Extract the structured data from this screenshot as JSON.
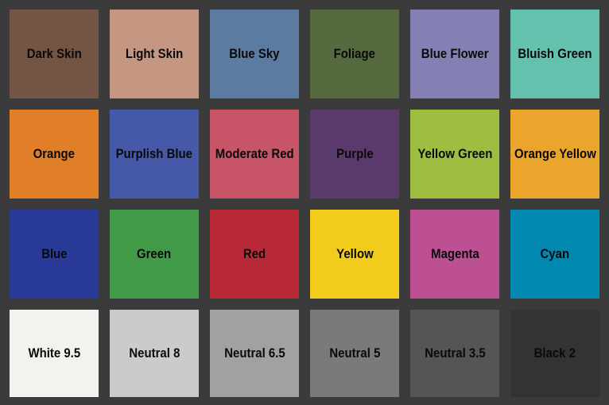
{
  "background_color": "#3b3b3b",
  "patches": [
    {
      "label": "Dark Skin",
      "color": "#745443"
    },
    {
      "label": "Light Skin",
      "color": "#c59682"
    },
    {
      "label": "Blue Sky",
      "color": "#5b7ba0"
    },
    {
      "label": "Foliage",
      "color": "#566a40"
    },
    {
      "label": "Blue Flower",
      "color": "#8580b3"
    },
    {
      "label": "Bluish Green",
      "color": "#63c1ae"
    },
    {
      "label": "Orange",
      "color": "#e07f28"
    },
    {
      "label": "Purplish Blue",
      "color": "#4559a8"
    },
    {
      "label": "Moderate Red",
      "color": "#c85467"
    },
    {
      "label": "Purple",
      "color": "#5a3a6c"
    },
    {
      "label": "Yellow Green",
      "color": "#9fbd40"
    },
    {
      "label": "Orange Yellow",
      "color": "#eba52c"
    },
    {
      "label": "Blue",
      "color": "#2a3a98"
    },
    {
      "label": "Green",
      "color": "#419a48"
    },
    {
      "label": "Red",
      "color": "#b92a38"
    },
    {
      "label": "Yellow",
      "color": "#f2cc1c"
    },
    {
      "label": "Magenta",
      "color": "#bd5092"
    },
    {
      "label": "Cyan",
      "color": "#0088b0"
    },
    {
      "label": "White 9.5",
      "color": "#f3f2ef"
    },
    {
      "label": "Neutral 8",
      "color": "#cbcbcb"
    },
    {
      "label": "Neutral 6.5",
      "color": "#a1a1a1"
    },
    {
      "label": "Neutral 5",
      "color": "#7a7a78"
    },
    {
      "label": "Neutral 3.5",
      "color": "#555555"
    },
    {
      "label": "Black 2",
      "color": "#333333"
    }
  ]
}
